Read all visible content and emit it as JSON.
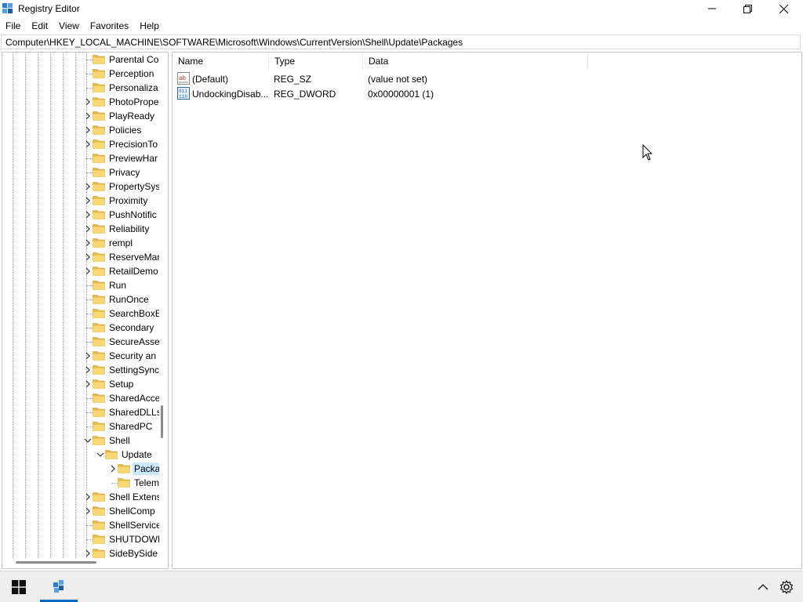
{
  "window": {
    "title": "Registry Editor"
  },
  "menu": [
    "File",
    "Edit",
    "View",
    "Favorites",
    "Help"
  ],
  "address": "Computer\\HKEY_LOCAL_MACHINE\\SOFTWARE\\Microsoft\\Windows\\CurrentVersion\\Shell\\Update\\Packages",
  "tree": {
    "items": [
      {
        "label": "Parental Co",
        "expander": "none"
      },
      {
        "label": "Perception",
        "expander": "none"
      },
      {
        "label": "Personaliza",
        "expander": "none"
      },
      {
        "label": "PhotoPrope",
        "expander": "collapsed"
      },
      {
        "label": "PlayReady",
        "expander": "collapsed"
      },
      {
        "label": "Policies",
        "expander": "collapsed"
      },
      {
        "label": "PrecisionTo",
        "expander": "collapsed"
      },
      {
        "label": "PreviewHar",
        "expander": "none"
      },
      {
        "label": "Privacy",
        "expander": "none"
      },
      {
        "label": "PropertySys",
        "expander": "collapsed"
      },
      {
        "label": "Proximity",
        "expander": "collapsed"
      },
      {
        "label": "PushNotific",
        "expander": "collapsed"
      },
      {
        "label": "Reliability",
        "expander": "collapsed"
      },
      {
        "label": "rempl",
        "expander": "collapsed"
      },
      {
        "label": "ReserveMar",
        "expander": "collapsed"
      },
      {
        "label": "RetailDemo",
        "expander": "collapsed"
      },
      {
        "label": "Run",
        "expander": "none"
      },
      {
        "label": "RunOnce",
        "expander": "none"
      },
      {
        "label": "SearchBoxE",
        "expander": "none"
      },
      {
        "label": "Secondary",
        "expander": "none"
      },
      {
        "label": "SecureAsse",
        "expander": "none"
      },
      {
        "label": "Security an",
        "expander": "collapsed"
      },
      {
        "label": "SettingSync",
        "expander": "collapsed"
      },
      {
        "label": "Setup",
        "expander": "collapsed"
      },
      {
        "label": "SharedAcce",
        "expander": "none"
      },
      {
        "label": "SharedDLLs",
        "expander": "none"
      },
      {
        "label": "SharedPC",
        "expander": "none"
      },
      {
        "label": "Shell",
        "expander": "expanded"
      },
      {
        "label": "Update",
        "expander": "expanded"
      },
      {
        "label": "Packa",
        "expander": "collapsed",
        "selected": true
      },
      {
        "label": "Telem",
        "expander": "none"
      },
      {
        "label": "Shell Extens",
        "expander": "collapsed"
      },
      {
        "label": "ShellComp",
        "expander": "collapsed"
      },
      {
        "label": "ShellService",
        "expander": "none"
      },
      {
        "label": "SHUTDOWN",
        "expander": "none"
      },
      {
        "label": "SideBySide",
        "expander": "collapsed"
      }
    ]
  },
  "values": {
    "columns": [
      "Name",
      "Type",
      "Data"
    ],
    "rows": [
      {
        "name": "(Default)",
        "type": "REG_SZ",
        "data": "(value not set)",
        "icon": "string-value-icon"
      },
      {
        "name": "UndockingDisab...",
        "type": "REG_DWORD",
        "data": "0x00000001 (1)",
        "icon": "binary-value-icon"
      }
    ]
  },
  "colors": {
    "selection": "#cce8ff",
    "folder": "#f8d775",
    "accent": "#0067c0"
  }
}
